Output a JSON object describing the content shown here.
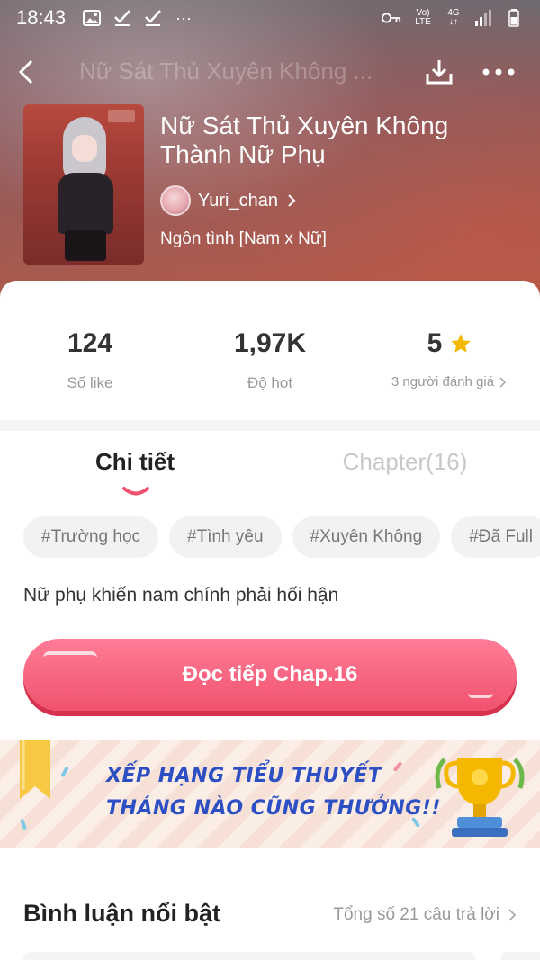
{
  "status_bar": {
    "time": "18:43",
    "ellipsis": "···",
    "volte_top": "Vo)",
    "volte_bottom": "LTE",
    "network": "4G"
  },
  "nav": {
    "title": "Nữ Sát Thủ Xuyên Không ..."
  },
  "story": {
    "title": "Nữ Sát Thủ Xuyên Không Thành Nữ Phụ",
    "author": "Yuri_chan",
    "genre": "Ngôn tình [Nam x Nữ]"
  },
  "stats": {
    "likes_value": "124",
    "likes_label": "Số like",
    "hot_value": "1,97K",
    "hot_label": "Độ hot",
    "rating_value": "5",
    "rating_label": "3 người đánh giá"
  },
  "tabs": {
    "detail": "Chi tiết",
    "chapter": "Chapter(16)"
  },
  "tags": [
    "#Trường học",
    "#Tình yêu",
    "#Xuyên Không",
    "#Đã Full"
  ],
  "description": "Nữ phụ khiến nam chính phải hối hận",
  "cta_label": "Đọc tiếp Chap.16",
  "banner": {
    "line1": "XẾP HẠNG TIỂU THUYẾT",
    "line2": "THÁNG NÀO CŨNG THƯỞNG!!"
  },
  "comments": {
    "title": "Bình luận nổi bật",
    "count": "Tổng số 21 câu trả lời"
  },
  "colors": {
    "accent": "#f0526f",
    "star": "#f5b800",
    "banner_text": "#2d4fc4"
  }
}
